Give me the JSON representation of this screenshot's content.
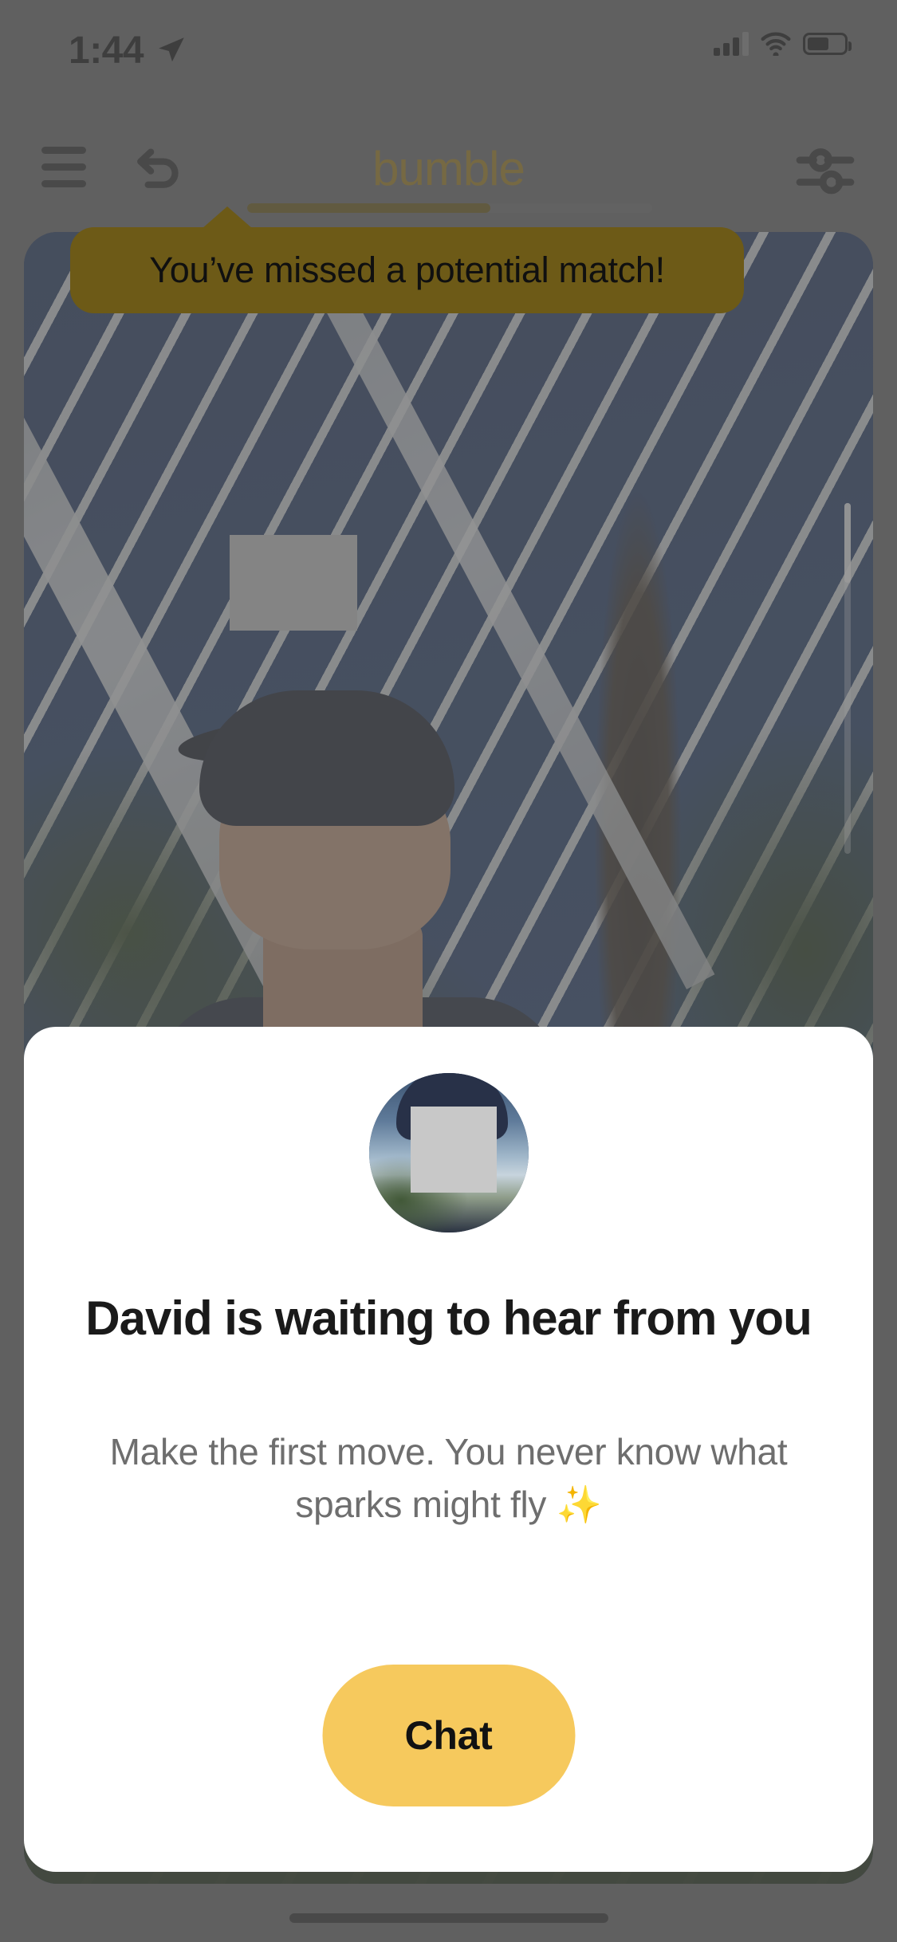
{
  "status_bar": {
    "time": "1:44",
    "location_icon": "location-arrow-icon",
    "cellular_icon": "cellular-signal-icon",
    "wifi_icon": "wifi-icon",
    "battery_icon": "battery-icon"
  },
  "nav": {
    "menu_icon": "hamburger-menu-icon",
    "undo_icon": "undo-rewind-icon",
    "brand": "bumble",
    "filter_icon": "filter-sliders-icon"
  },
  "progress": {
    "percent": 60,
    "fill_color": "#6d5a17",
    "track_color": "#6f6f6f"
  },
  "tooltip": {
    "text": "You’ve missed a potential match!",
    "bg_color": "#6d5a17",
    "text_color": "#101010"
  },
  "photo_card": {
    "scroll_indicator": "photo-scroll-indicator",
    "face_blur": "face-blur-redaction"
  },
  "sheet": {
    "avatar": "profile-avatar",
    "avatar_blur": "avatar-face-blur-redaction",
    "title": "David is waiting to hear from you",
    "subtitle": "Make the first move. You never know what sparks might fly ✨",
    "chat_label": "Chat",
    "chat_bg_color": "#f6c95d",
    "card_bg_color": "#ffffff"
  },
  "tabbar": {
    "items": [
      {
        "name": "tab-profile",
        "icon": "person-icon"
      },
      {
        "name": "tab-discover",
        "icon": "hexagon-icon"
      },
      {
        "name": "tab-likes",
        "icon": "heart-icon"
      },
      {
        "name": "tab-chat",
        "icon": "chat-bubble-icon"
      }
    ]
  },
  "home_indicator": "home-indicator-bar",
  "theme": {
    "brand_gold": "#a2811e",
    "scrim": "rgba(90,90,90,.62)"
  }
}
